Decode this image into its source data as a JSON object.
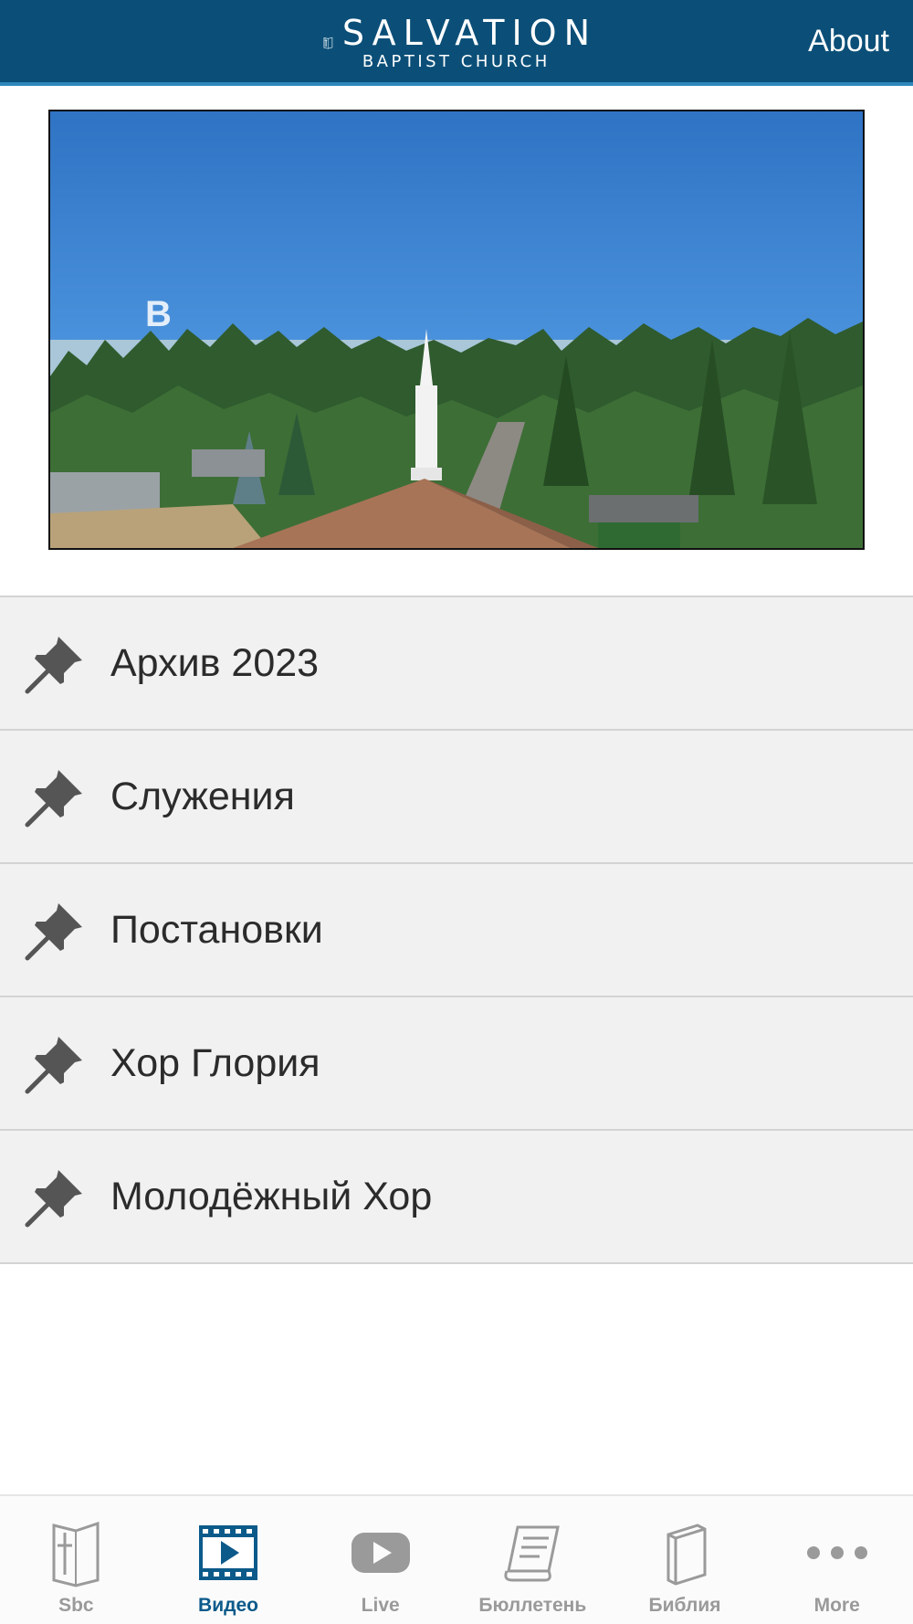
{
  "header": {
    "logo_line1": "SALVATION",
    "logo_line2": "BAPTIST CHURCH",
    "about_label": "About"
  },
  "hero": {
    "overlay_letter": "B"
  },
  "menu_items": [
    {
      "label": "Архив 2023",
      "icon": "pushpin-icon"
    },
    {
      "label": "Служения",
      "icon": "pushpin-icon"
    },
    {
      "label": "Постановки",
      "icon": "pushpin-icon"
    },
    {
      "label": "Хор Глория",
      "icon": "pushpin-icon"
    },
    {
      "label": "Молодёжный Хор",
      "icon": "pushpin-icon"
    }
  ],
  "tabs": [
    {
      "label": "Sbc",
      "icon": "cross-book-icon",
      "active": false
    },
    {
      "label": "Видео",
      "icon": "video-film-icon",
      "active": true
    },
    {
      "label": "Live",
      "icon": "youtube-play-icon",
      "active": false
    },
    {
      "label": "Бюллетень",
      "icon": "scroll-icon",
      "active": false
    },
    {
      "label": "Библия",
      "icon": "bible-book-icon",
      "active": false
    },
    {
      "label": "More",
      "icon": "more-dots-icon",
      "active": false
    }
  ],
  "colors": {
    "header_bg": "#0b4f78",
    "accent": "#0c5a8a",
    "tab_inactive": "#9a9a9a",
    "row_bg": "#f1f1f1"
  }
}
